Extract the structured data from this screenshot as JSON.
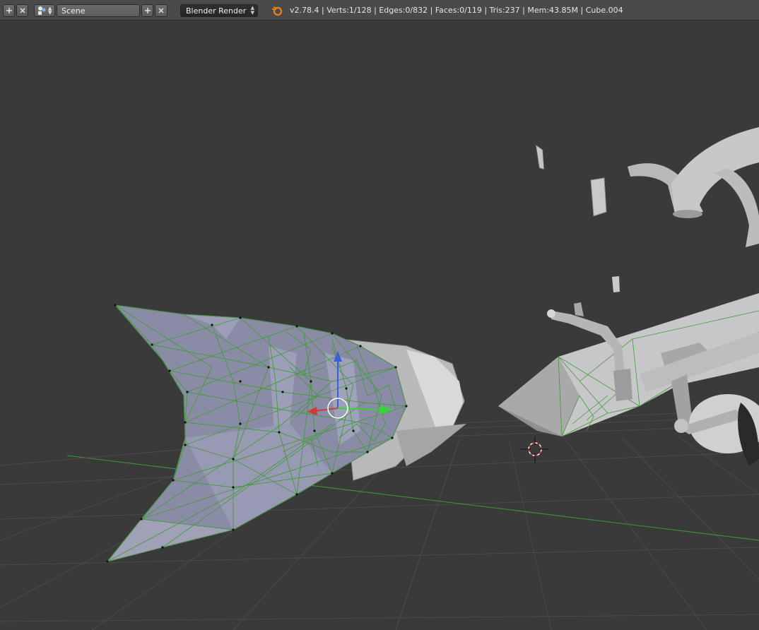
{
  "header": {
    "scene_name": "Scene",
    "render_engine": "Blender Render",
    "stats": "v2.78.4 | Verts:1/128 | Edges:0/832 | Faces:0/119 | Tris:237 | Mem:43.85M | Cube.004"
  },
  "icons": {
    "screen_add": "plus-icon",
    "screen_close": "close-icon",
    "scene_browse": "scene-icon",
    "scene_add": "plus-icon",
    "scene_close": "close-icon",
    "blender": "blender-logo-icon",
    "cursor": "3d-cursor-icon",
    "manipulator": "transform-manipulator-icon"
  },
  "colors": {
    "header_bg": "#4a4a4a",
    "viewport_bg": "#3a3a3a",
    "grid": "#4d4d4d",
    "x_axis": "#b8413e",
    "y_axis": "#3a8f3a",
    "wire_selected": "#3f9b34",
    "mesh_face": "#8c8ea8"
  }
}
